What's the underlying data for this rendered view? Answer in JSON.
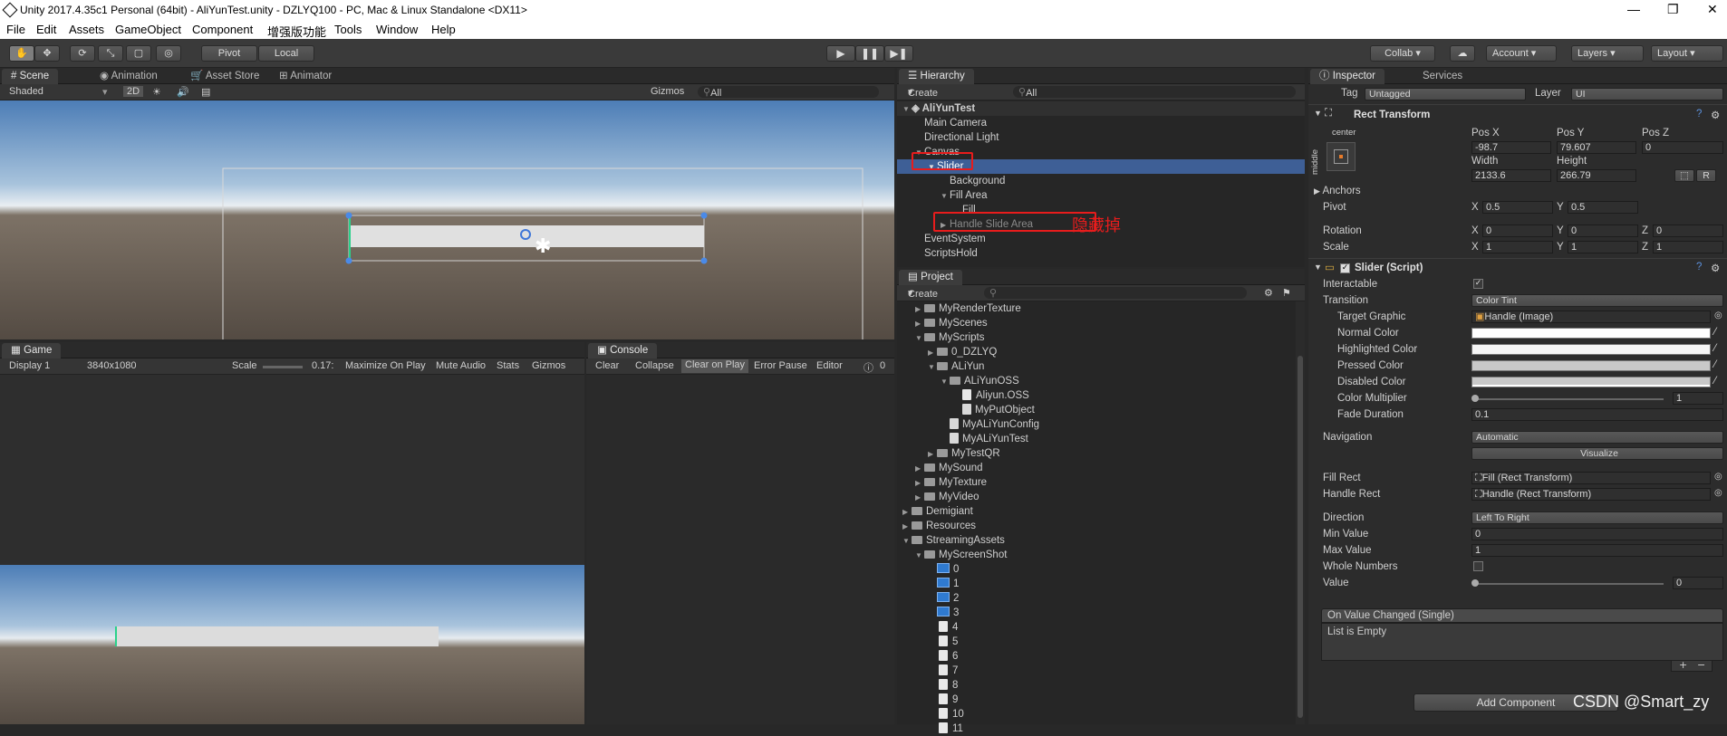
{
  "window": {
    "title": "Unity 2017.4.35c1 Personal (64bit) - AliYunTest.unity - DZLYQ100 - PC, Mac & Linux Standalone <DX11>",
    "min_glyph": "—",
    "max_glyph": "❐",
    "close_glyph": "✕"
  },
  "menu": [
    "File",
    "Edit",
    "Assets",
    "GameObject",
    "Component",
    "增强版功能",
    "Tools",
    "Window",
    "Help"
  ],
  "toolbar": {
    "pivot": "Pivot",
    "local": "Local",
    "collab": "Collab ▾",
    "account": "Account",
    "layers": "Layers",
    "layout": "Layout"
  },
  "scene": {
    "tab": "Scene",
    "tab2": "Animation",
    "tab3": "Asset Store",
    "tab4": "Animator",
    "shading": "Shaded",
    "mode2d": "2D",
    "gizmos": "Gizmos",
    "search": "All"
  },
  "game": {
    "tab": "Game",
    "display": "Display 1",
    "resolution": "3840x1080",
    "scale_label": "Scale",
    "scale_value": "0.17:",
    "maximize": "Maximize On Play",
    "mute": "Mute Audio",
    "stats": "Stats",
    "gizmos": "Gizmos"
  },
  "console": {
    "tab": "Console",
    "clear": "Clear",
    "collapse": "Collapse",
    "clear_on_play": "Clear on Play",
    "error_pause": "Error Pause",
    "editor": "Editor",
    "count": "0"
  },
  "hierarchy": {
    "tab": "Hierarchy",
    "create": "Create",
    "search": "All",
    "scene": "AliYunTest",
    "items": [
      "Main Camera",
      "Directional Light",
      "Canvas",
      "Slider",
      "Background",
      "Fill Area",
      "Fill",
      "Handle Slide Area",
      "EventSystem",
      "ScriptsHold"
    ],
    "annotation": "隐藏掉"
  },
  "project": {
    "tab": "Project",
    "create": "Create",
    "items": [
      "MyRenderTexture",
      "MyScenes",
      "MyScripts",
      "0_DZLYQ",
      "ALiYun",
      "ALiYunOSS",
      "Aliyun.OSS",
      "MyPutObject",
      "MyALiYunConfig",
      "MyALiYunTest",
      "MyTestQR",
      "MySound",
      "MyTexture",
      "MyVideo",
      "Demigiant",
      "Resources",
      "StreamingAssets",
      "MyScreenShot",
      "0",
      "1",
      "2",
      "3",
      "4",
      "5",
      "6",
      "7",
      "8",
      "9",
      "10",
      "11"
    ]
  },
  "inspector": {
    "tab": "Inspector",
    "tab2": "Services",
    "tag_label": "Tag",
    "tag_value": "Untagged",
    "layer_label": "Layer",
    "layer_value": "UI",
    "rect_transform": {
      "title": "Rect Transform",
      "anchor_h": "center",
      "anchor_v": "middle",
      "posx_label": "Pos X",
      "posy_label": "Pos Y",
      "posz_label": "Pos Z",
      "posx": "-98.7",
      "posy": "79.607",
      "posz": "0",
      "width_label": "Width",
      "height_label": "Height",
      "width": "2133.6",
      "height": "266.79",
      "r_btn": "R",
      "anchors": "Anchors",
      "pivot": "Pivot",
      "pivot_x": "0.5",
      "pivot_y": "0.5",
      "rotation": "Rotation",
      "rot_x": "0",
      "rot_y": "0",
      "rot_z": "0",
      "scale": "Scale",
      "scale_x": "1",
      "scale_y": "1",
      "scale_z": "1",
      "x": "X",
      "y": "Y",
      "z": "Z"
    },
    "slider": {
      "title": "Slider (Script)",
      "interactable": "Interactable",
      "transition": "Transition",
      "transition_value": "Color Tint",
      "target_graphic": "Target Graphic",
      "target_graphic_value": "Handle (Image)",
      "normal_color": "Normal Color",
      "highlighted_color": "Highlighted Color",
      "pressed_color": "Pressed Color",
      "disabled_color": "Disabled Color",
      "color_multiplier": "Color Multiplier",
      "color_multiplier_value": "1",
      "fade_duration": "Fade Duration",
      "fade_duration_value": "0.1",
      "navigation": "Navigation",
      "navigation_value": "Automatic",
      "visualize": "Visualize",
      "fill_rect": "Fill Rect",
      "fill_rect_value": "Fill (Rect Transform)",
      "handle_rect": "Handle Rect",
      "handle_rect_value": "Handle (Rect Transform)",
      "direction": "Direction",
      "direction_value": "Left To Right",
      "min_value": "Min Value",
      "min_value_value": "0",
      "max_value": "Max Value",
      "max_value_value": "1",
      "whole_numbers": "Whole Numbers",
      "value": "Value",
      "value_value": "0",
      "event_title": "On Value Changed (Single)",
      "event_empty": "List is Empty"
    },
    "add_component": "Add Component"
  },
  "watermark": "CSDN @Smart_zy",
  "colors": {
    "highlight": "#3e5f96",
    "annotation_red": "#e81c1c"
  }
}
